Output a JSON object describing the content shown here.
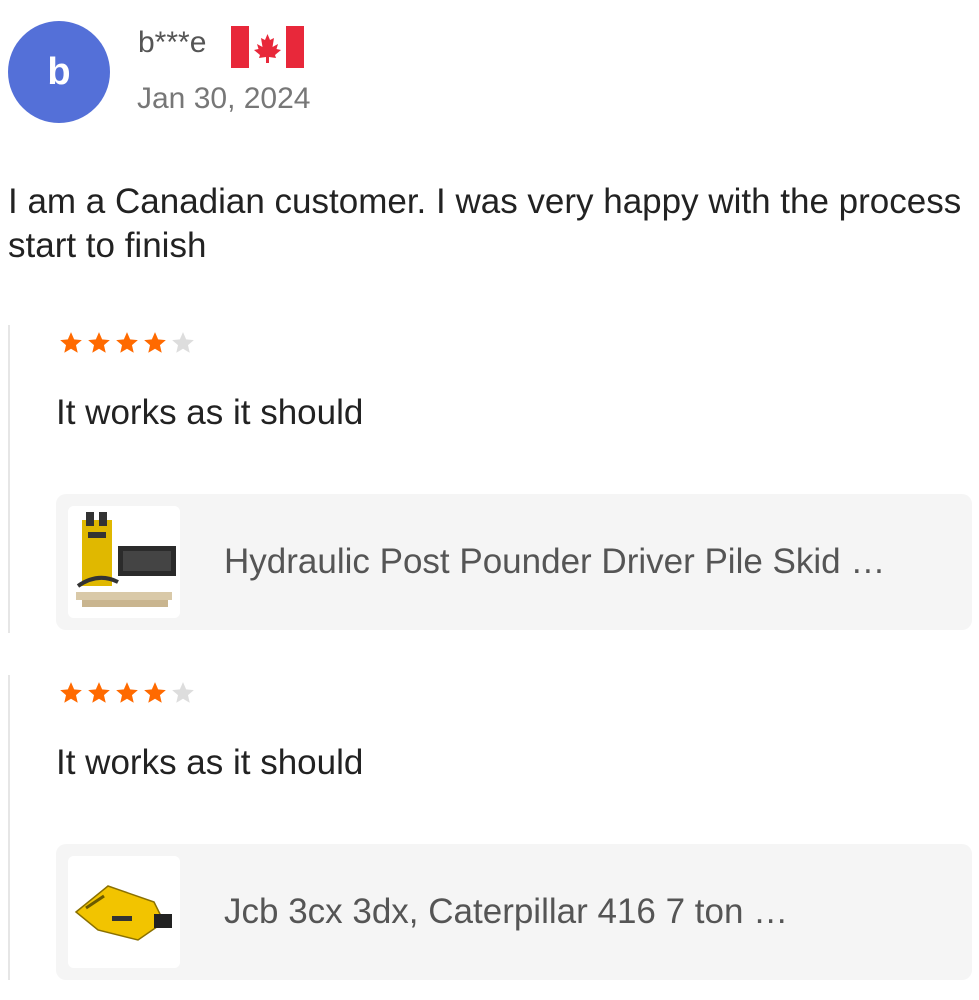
{
  "reviewer": {
    "avatar_letter": "b",
    "name": "b***e",
    "country_flag": "canada-flag-icon",
    "date": "Jan 30, 2024"
  },
  "review": {
    "text": "I am a Canadian customer. I was very happy with the process start to finish"
  },
  "colors": {
    "avatar_bg": "#5470d8",
    "star_filled": "#ff6a00",
    "star_empty": "#dddddd"
  },
  "items": [
    {
      "rating": 4,
      "rating_max": 5,
      "text": "It works as it should",
      "product_title": "Hydraulic Post Pounder Driver Pile Skid …",
      "thumbnail": "post-pounder-product-icon"
    },
    {
      "rating": 4,
      "rating_max": 5,
      "text": "It works as it should",
      "product_title": "Jcb 3cx 3dx, Caterpillar 416 7 ton …",
      "thumbnail": "hydraulic-breaker-product-icon"
    }
  ]
}
